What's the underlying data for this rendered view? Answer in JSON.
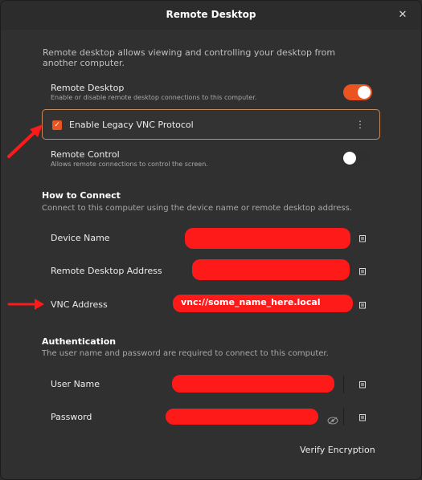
{
  "window": {
    "title": "Remote Desktop"
  },
  "intro": "Remote desktop allows viewing and controlling your desktop from another computer.",
  "remote_desktop": {
    "label": "Remote Desktop",
    "sub": "Enable or disable remote desktop connections to this computer.",
    "enabled": true
  },
  "legacy_vnc": {
    "label": "Enable Legacy VNC Protocol",
    "checked": true
  },
  "remote_control": {
    "label": "Remote Control",
    "sub": "Allows remote connections to control the screen.",
    "enabled": false
  },
  "how_to_connect": {
    "title": "How to Connect",
    "desc": "Connect to this computer using the device name or remote desktop address.",
    "rows": {
      "device_name": {
        "label": "Device Name"
      },
      "remote_address": {
        "label": "Remote Desktop Address"
      },
      "vnc_address": {
        "label": "VNC Address",
        "value": "vnc://some_name_here.local"
      }
    }
  },
  "authentication": {
    "title": "Authentication",
    "desc": "The user name and password are required to connect to this computer.",
    "rows": {
      "user_name": {
        "label": "User Name"
      },
      "password": {
        "label": "Password"
      }
    }
  },
  "verify_button": "Verify Encryption",
  "colors": {
    "accent": "#e95420",
    "annotation_red": "#ff1a1a",
    "background": "#303030"
  },
  "icons": [
    "close-icon",
    "kebab-menu-icon",
    "copy-icon",
    "eye-hidden-icon",
    "checkmark-icon"
  ]
}
